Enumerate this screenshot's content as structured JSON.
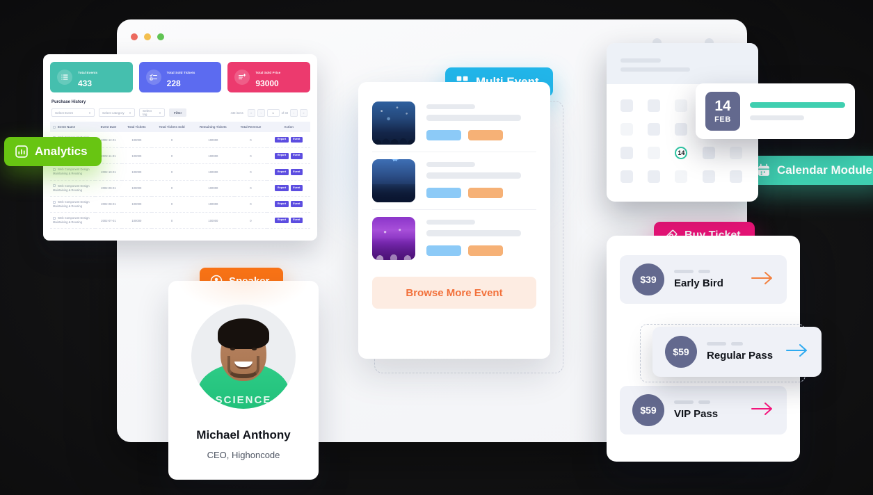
{
  "window": {
    "traffic_lights": [
      "red",
      "yellow",
      "green"
    ]
  },
  "dashboard": {
    "stats": [
      {
        "label": "Total Events",
        "value": "433",
        "color": "#45bfae",
        "icon": "list-icon"
      },
      {
        "label": "Total Sold Tickets",
        "value": "228",
        "color": "#5c6bf0",
        "icon": "checklist-icon"
      },
      {
        "label": "Total Sold Price",
        "value": "93000",
        "color": "#ec3a6e",
        "icon": "add-lines-icon"
      }
    ],
    "section_title": "Purchase History",
    "filters": {
      "event_select": "Select Event",
      "category_select": "Select category",
      "tag_select": "Select tag",
      "filter_button": "Filter"
    },
    "pagination": {
      "items_text": "433 items",
      "first": "«",
      "prev": "‹",
      "current_page": "1",
      "of_text": "of 33",
      "next": "›",
      "last": "»"
    },
    "table": {
      "columns": [
        "Event Name",
        "Event Date",
        "Total Tickets",
        "Total Tickets Sold",
        "Remaining Tickets",
        "Total Revenue",
        "Action"
      ],
      "rows": [
        {
          "name": "Web Component Design Maintaining & Reusing",
          "date": "2002-12-01",
          "total": "100000",
          "sold": "0",
          "remaining": "100000",
          "revenue": "0",
          "actions": [
            "Report",
            "Event"
          ]
        },
        {
          "name": "Web Component Design Maintaining & Reusing",
          "date": "2002-11-01",
          "total": "100000",
          "sold": "0",
          "remaining": "100000",
          "revenue": "0",
          "actions": [
            "Report",
            "Event"
          ]
        },
        {
          "name": "Web Component Design Maintaining & Reusing",
          "date": "2002-10-01",
          "total": "100000",
          "sold": "0",
          "remaining": "100000",
          "revenue": "0",
          "actions": [
            "Report",
            "Event"
          ]
        },
        {
          "name": "Web Component Design Maintaining & Reusing",
          "date": "2002-09-01",
          "total": "100000",
          "sold": "0",
          "remaining": "100000",
          "revenue": "0",
          "actions": [
            "Report",
            "Event"
          ]
        },
        {
          "name": "Web Component Design Maintaining & Reusing",
          "date": "2002-08-01",
          "total": "100000",
          "sold": "0",
          "remaining": "100000",
          "revenue": "0",
          "actions": [
            "Report",
            "Event"
          ]
        },
        {
          "name": "Web Component Design Maintaining & Reusing",
          "date": "2002-07-01",
          "total": "100000",
          "sold": "0",
          "remaining": "100000",
          "revenue": "0",
          "actions": [
            "Report",
            "Event"
          ]
        }
      ]
    }
  },
  "badges": {
    "analytics": {
      "label": "Analytics",
      "icon": "bar-chart-icon",
      "color": "#68c512"
    },
    "multi_event": {
      "label": "Multi Event",
      "icon": "grid-plus-icon",
      "color": "#22b6ea"
    },
    "calendar_module": {
      "label": "Calendar Module",
      "icon": "calendar-icon",
      "color": "#3fcfb0"
    },
    "speaker": {
      "label": "Speaker",
      "icon": "user-circle-icon",
      "color": "#f97316"
    },
    "buy_ticket": {
      "label": "Buy Ticket",
      "icon": "ticket-icon",
      "color": "#f5147c"
    }
  },
  "event_list": {
    "items": [
      {
        "thumb": "concert-crowd-photo",
        "tag_primary": "",
        "tag_secondary": ""
      },
      {
        "thumb": "stage-lights-photo",
        "tag_primary": "",
        "tag_secondary": ""
      },
      {
        "thumb": "purple-venue-photo",
        "tag_primary": "",
        "tag_secondary": ""
      }
    ],
    "browse_button": "Browse More Event"
  },
  "speaker_card": {
    "name": "Michael Anthony",
    "role": "CEO, Highoncode",
    "photo": "speaker-portrait"
  },
  "calendar": {
    "selected_day": "14",
    "date_detail": {
      "day": "14",
      "month": "FEB"
    }
  },
  "tickets": [
    {
      "price": "$39",
      "name": "Early Bird",
      "arrow_color": "#f2803f"
    },
    {
      "price": "$59",
      "name": "Regular Pass",
      "arrow_color": "#2eaaf0"
    },
    {
      "price": "$59",
      "name": "VIP Pass",
      "arrow_color": "#f5147c"
    }
  ]
}
